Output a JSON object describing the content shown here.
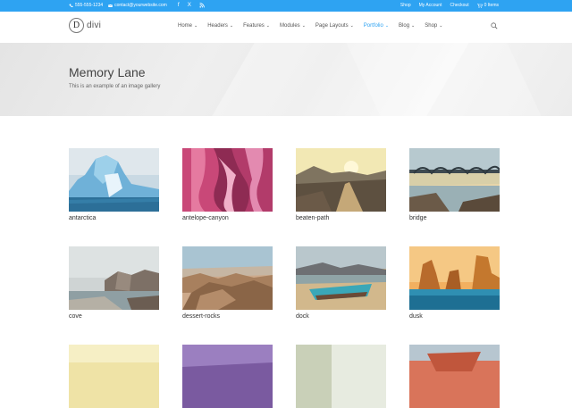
{
  "topbar": {
    "phone": "555-555-1234",
    "email": "contact@yourwebsite.com",
    "social": [
      "f",
      "X",
      "rss"
    ],
    "links": [
      "Shop",
      "My Account",
      "Checkout",
      "0 Items"
    ]
  },
  "header": {
    "logo_letter": "D",
    "logo_text": "divi",
    "nav": [
      {
        "label": "Home",
        "active": false
      },
      {
        "label": "Headers",
        "active": false
      },
      {
        "label": "Features",
        "active": false
      },
      {
        "label": "Modules",
        "active": false
      },
      {
        "label": "Page Layouts",
        "active": false
      },
      {
        "label": "Portfolio",
        "active": true
      },
      {
        "label": "Blog",
        "active": false
      },
      {
        "label": "Shop",
        "active": false
      }
    ]
  },
  "hero": {
    "title": "Memory Lane",
    "subtitle": "This is an example of an image gallery"
  },
  "gallery": [
    {
      "caption": "antarctica",
      "icon": "iceberg-image"
    },
    {
      "caption": "antelope-canyon",
      "icon": "canyon-image"
    },
    {
      "caption": "beaten-path",
      "icon": "path-image"
    },
    {
      "caption": "bridge",
      "icon": "bridge-image"
    },
    {
      "caption": "cove",
      "icon": "cove-image"
    },
    {
      "caption": "dessert-rocks",
      "icon": "desert-image"
    },
    {
      "caption": "dock",
      "icon": "boat-image"
    },
    {
      "caption": "dusk",
      "icon": "dusk-image"
    },
    {
      "caption": "",
      "icon": "yellow-image"
    },
    {
      "caption": "",
      "icon": "purple-image"
    },
    {
      "caption": "",
      "icon": "light-image"
    },
    {
      "caption": "",
      "icon": "red-rock-image"
    }
  ],
  "colors": {
    "accent": "#2ea3f2"
  }
}
